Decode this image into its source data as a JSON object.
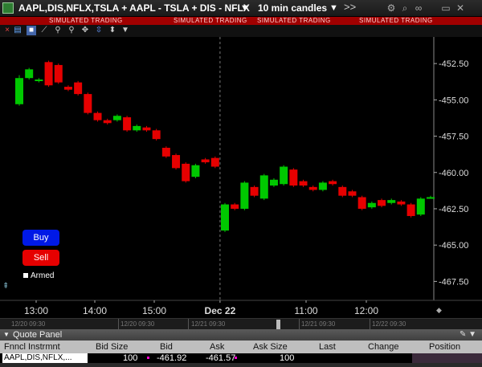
{
  "window": {
    "title": "AAPL,DIS,NFLX,TSLA + AAPL - TSLA + DIS - NFLX",
    "interval": "10 min candles",
    "dropdown_glyph": "▼",
    "more_glyph": ">>",
    "icons": [
      "gear-icon",
      "search-icon",
      "link-icon",
      "restore-icon",
      "close-icon"
    ]
  },
  "simulated_label": "SIMULATED TRADING",
  "toolbar": {
    "close_glyph": "×",
    "tools": [
      "stack-icon",
      "window-icon",
      "draw-line-icon",
      "magnifier-plus-icon",
      "magnifier-minus-icon",
      "crosshair-icon",
      "zoom-icon",
      "dropdown-icon"
    ]
  },
  "chart_data": {
    "type": "candlestick",
    "x_ticks": [
      "13:00",
      "14:00",
      "15:00",
      "Dec 22",
      "11:00",
      "12:00"
    ],
    "y_ticks": [
      "-452.50",
      "-455.00",
      "-457.50",
      "-460.00",
      "-462.50",
      "-465.00",
      "-467.50"
    ],
    "ylim": [
      -468.75,
      -451.0
    ],
    "session_divider_label": "Dec 22",
    "candles": [
      {
        "o": -455.3,
        "c": -453.5,
        "h": -453.3,
        "l": -455.4
      },
      {
        "o": -453.5,
        "c": -452.9,
        "h": -452.8,
        "l": -453.6
      },
      {
        "o": -453.7,
        "c": -453.6,
        "h": -453.5,
        "l": -453.8
      },
      {
        "o": -452.4,
        "c": -454.0,
        "h": -452.3,
        "l": -454.1
      },
      {
        "o": -452.6,
        "c": -453.8,
        "h": -452.5,
        "l": -453.9
      },
      {
        "o": -454.1,
        "c": -454.3,
        "h": -454.0,
        "l": -454.4
      },
      {
        "o": -453.8,
        "c": -454.6,
        "h": -453.7,
        "l": -454.7
      },
      {
        "o": -454.6,
        "c": -455.9,
        "h": -454.5,
        "l": -456.0
      },
      {
        "o": -455.9,
        "c": -456.4,
        "h": -455.8,
        "l": -456.5
      },
      {
        "o": -456.4,
        "c": -456.6,
        "h": -456.3,
        "l": -456.7
      },
      {
        "o": -456.4,
        "c": -456.1,
        "h": -456.0,
        "l": -456.5
      },
      {
        "o": -456.2,
        "c": -457.1,
        "h": -456.1,
        "l": -457.2
      },
      {
        "o": -457.1,
        "c": -456.8,
        "h": -456.7,
        "l": -457.2
      },
      {
        "o": -456.9,
        "c": -457.1,
        "h": -456.8,
        "l": -457.2
      },
      {
        "o": -457.1,
        "c": -457.7,
        "h": -457.0,
        "l": -457.8
      },
      {
        "o": -458.3,
        "c": -458.9,
        "h": -458.2,
        "l": -459.0
      },
      {
        "o": -458.8,
        "c": -459.7,
        "h": -458.7,
        "l": -459.8
      },
      {
        "o": -459.4,
        "c": -460.6,
        "h": -459.3,
        "l": -460.7
      },
      {
        "o": -460.3,
        "c": -459.5,
        "h": -459.4,
        "l": -460.4
      },
      {
        "o": -459.1,
        "c": -459.3,
        "h": -459.0,
        "l": -459.4
      },
      {
        "o": -459.0,
        "c": -459.6,
        "h": -458.9,
        "l": -459.7
      },
      {
        "o": -464.0,
        "c": -462.2,
        "h": -462.1,
        "l": -464.1
      },
      {
        "o": -462.2,
        "c": -462.5,
        "h": -462.1,
        "l": -462.6
      },
      {
        "o": -462.5,
        "c": -460.7,
        "h": -460.6,
        "l": -462.6
      },
      {
        "o": -461.0,
        "c": -461.6,
        "h": -460.9,
        "l": -461.7
      },
      {
        "o": -461.8,
        "c": -460.2,
        "h": -460.1,
        "l": -461.9
      },
      {
        "o": -460.9,
        "c": -460.5,
        "h": -460.4,
        "l": -461.0
      },
      {
        "o": -460.8,
        "c": -459.6,
        "h": -459.5,
        "l": -460.9
      },
      {
        "o": -459.8,
        "c": -460.9,
        "h": -459.7,
        "l": -461.0
      },
      {
        "o": -460.6,
        "c": -460.9,
        "h": -460.5,
        "l": -461.0
      },
      {
        "o": -461.0,
        "c": -461.2,
        "h": -460.9,
        "l": -461.3
      },
      {
        "o": -461.2,
        "c": -460.7,
        "h": -460.6,
        "l": -461.3
      },
      {
        "o": -460.6,
        "c": -460.8,
        "h": -460.5,
        "l": -460.9
      },
      {
        "o": -461.0,
        "c": -461.6,
        "h": -460.9,
        "l": -461.7
      },
      {
        "o": -461.3,
        "c": -461.6,
        "h": -461.2,
        "l": -461.7
      },
      {
        "o": -461.7,
        "c": -462.5,
        "h": -461.6,
        "l": -462.6
      },
      {
        "o": -462.4,
        "c": -462.1,
        "h": -462.0,
        "l": -462.5
      },
      {
        "o": -461.9,
        "c": -462.3,
        "h": -461.8,
        "l": -462.4
      },
      {
        "o": -462.1,
        "c": -461.9,
        "h": -461.8,
        "l": -462.2
      },
      {
        "o": -462.0,
        "c": -462.2,
        "h": -461.9,
        "l": -462.3
      },
      {
        "o": -462.2,
        "c": -463.0,
        "h": -462.1,
        "l": -463.1
      },
      {
        "o": -462.9,
        "c": -461.8,
        "h": -461.7,
        "l": -463.0
      },
      {
        "o": -461.7,
        "c": -461.7,
        "h": -461.6,
        "l": -461.8
      }
    ]
  },
  "order_panel": {
    "buy_label": "Buy",
    "sell_label": "Sell",
    "armed_label": "Armed"
  },
  "timeline": {
    "labels": [
      "12/20 09:30",
      "12/20 09:30",
      "12/21 09:30",
      "12/21 09:30",
      "12/22 09:30"
    ]
  },
  "quote_panel": {
    "title": "Quote Panel",
    "columns": [
      "Fnncl Instrmnt",
      "Bid Size",
      "Bid",
      "Ask",
      "Ask Size",
      "Last",
      "Change",
      "Position"
    ],
    "row": {
      "instrument": "AAPL,DIS,NFLX,...",
      "bid_size": "100",
      "bid": "-461.92",
      "ask": "-461.57",
      "ask_size": "100",
      "last": "",
      "change": "",
      "position": ""
    }
  },
  "colors": {
    "up": "#00c800",
    "down": "#e60000",
    "buy": "#0019e6",
    "sell": "#e60000",
    "sim_bar": "#a00000"
  }
}
